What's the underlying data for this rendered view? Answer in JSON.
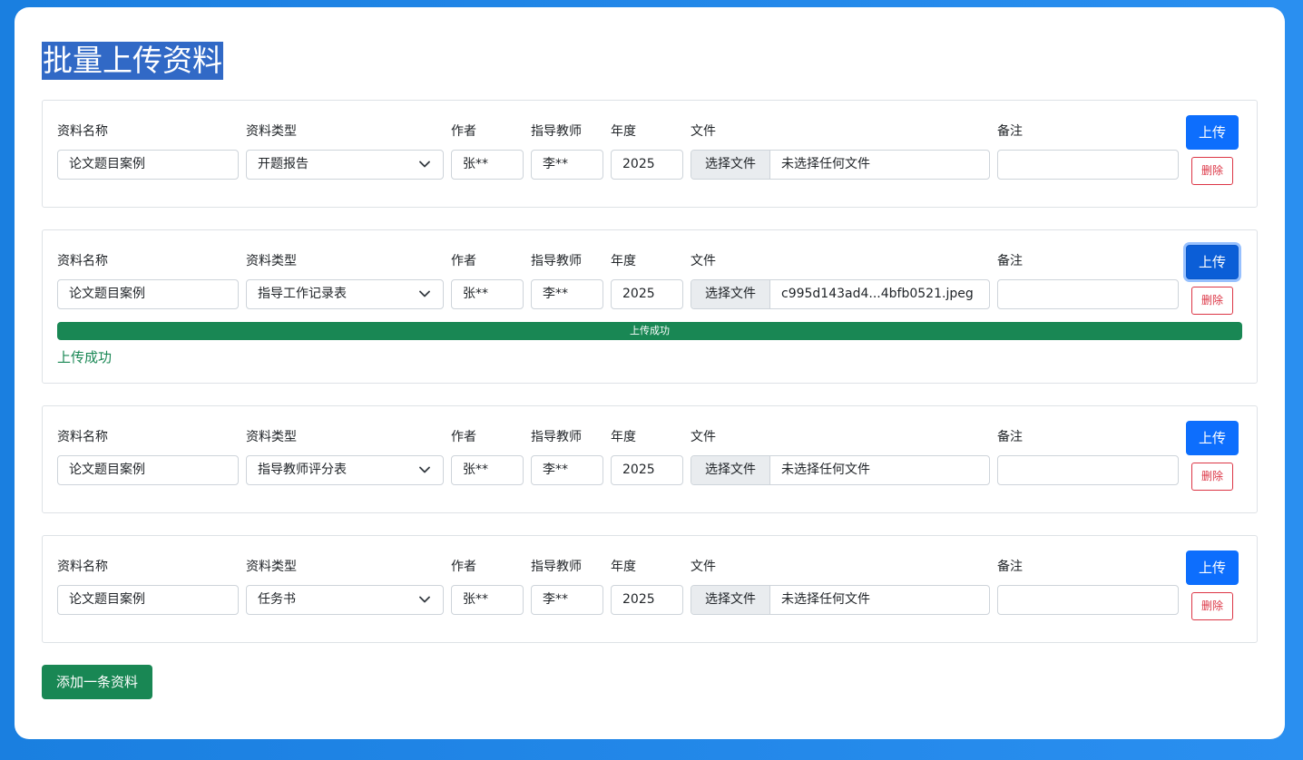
{
  "page": {
    "title": "批量上传资料",
    "add_button": "添加一条资料"
  },
  "labels": {
    "name": "资料名称",
    "type": "资料类型",
    "author": "作者",
    "advisor": "指导教师",
    "year": "年度",
    "file": "文件",
    "remark": "备注"
  },
  "buttons": {
    "upload": "上传",
    "delete": "删除",
    "choose_file": "选择文件"
  },
  "colors": {
    "primary": "#0d6efd",
    "success": "#198754",
    "danger": "#dc3545"
  },
  "rows": [
    {
      "name": "论文题目案例",
      "type": "开题报告",
      "author": "张**",
      "advisor": "李**",
      "year": "2025",
      "file_name": "未选择任何文件",
      "remark": ""
    },
    {
      "name": "论文题目案例",
      "type": "指导工作记录表",
      "author": "张**",
      "advisor": "李**",
      "year": "2025",
      "file_name": "c995d143ad4...4bfb0521.jpeg",
      "remark": "",
      "progress_text": "上传成功",
      "progress_percent": 100,
      "status_text": "上传成功"
    },
    {
      "name": "论文题目案例",
      "type": "指导教师评分表",
      "author": "张**",
      "advisor": "李**",
      "year": "2025",
      "file_name": "未选择任何文件",
      "remark": ""
    },
    {
      "name": "论文题目案例",
      "type": "任务书",
      "author": "张**",
      "advisor": "李**",
      "year": "2025",
      "file_name": "未选择任何文件",
      "remark": ""
    }
  ]
}
